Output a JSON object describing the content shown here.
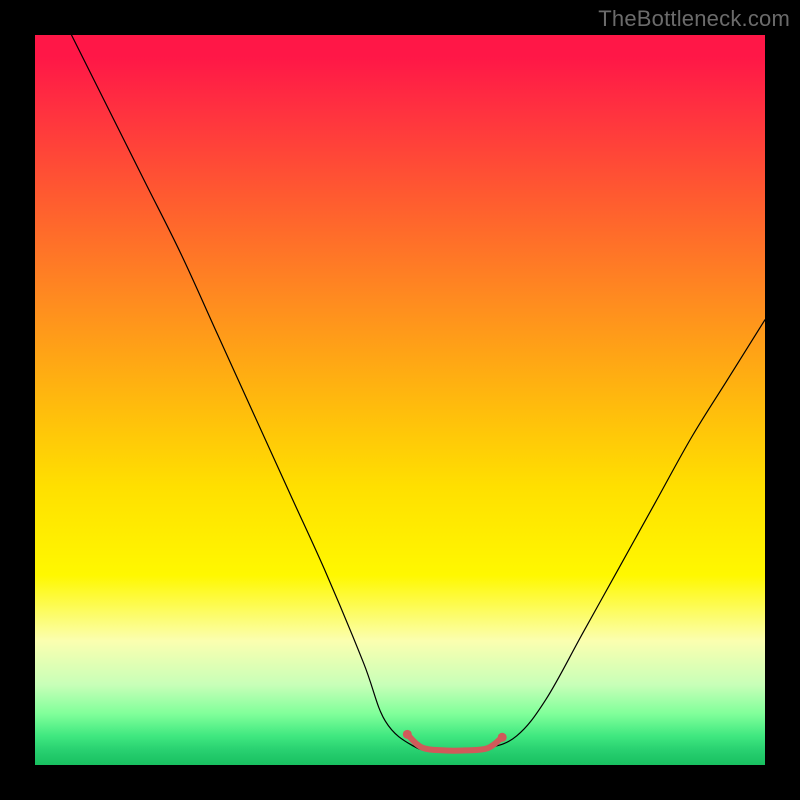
{
  "watermark": "TheBottleneck.com",
  "chart_data": {
    "type": "line",
    "title": "",
    "xlabel": "",
    "ylabel": "",
    "xlim": [
      0,
      100
    ],
    "ylim": [
      0,
      100
    ],
    "grid": false,
    "legend": false,
    "background_gradient": {
      "stops": [
        {
          "pos": 0.0,
          "color": "#ff1747"
        },
        {
          "pos": 0.03,
          "color": "#ff1747"
        },
        {
          "pos": 0.1,
          "color": "#ff3040"
        },
        {
          "pos": 0.22,
          "color": "#ff5a30"
        },
        {
          "pos": 0.36,
          "color": "#ff8a20"
        },
        {
          "pos": 0.48,
          "color": "#ffb210"
        },
        {
          "pos": 0.62,
          "color": "#ffe000"
        },
        {
          "pos": 0.74,
          "color": "#fff800"
        },
        {
          "pos": 0.83,
          "color": "#fbffb0"
        },
        {
          "pos": 0.89,
          "color": "#c8ffb8"
        },
        {
          "pos": 0.93,
          "color": "#80ff9a"
        },
        {
          "pos": 0.96,
          "color": "#40e880"
        },
        {
          "pos": 0.98,
          "color": "#28d070"
        },
        {
          "pos": 1.0,
          "color": "#18c060"
        }
      ]
    },
    "series": [
      {
        "name": "bottleneck-curve",
        "color": "#000000",
        "stroke_width": 1.2,
        "x": [
          5,
          10,
          15,
          20,
          25,
          30,
          35,
          40,
          45,
          48,
          52,
          55,
          58,
          62,
          66,
          70,
          75,
          80,
          85,
          90,
          95,
          100
        ],
        "y": [
          100,
          90,
          80,
          70,
          59,
          48,
          37,
          26,
          14,
          6,
          2.5,
          2,
          2,
          2.3,
          4,
          9,
          18,
          27,
          36,
          45,
          53,
          61
        ]
      },
      {
        "name": "optimal-range-highlight",
        "color": "#d05a5a",
        "stroke_width": 6,
        "x": [
          51,
          53,
          56,
          59,
          62,
          64
        ],
        "y": [
          4.2,
          2.4,
          2.0,
          2.0,
          2.3,
          3.8
        ]
      }
    ],
    "markers": [
      {
        "name": "optimal-start-dot",
        "x": 51,
        "y": 4.2,
        "color": "#d05a5a",
        "r": 4.5
      },
      {
        "name": "optimal-end-dot",
        "x": 64,
        "y": 3.8,
        "color": "#d05a5a",
        "r": 4.5
      }
    ]
  }
}
